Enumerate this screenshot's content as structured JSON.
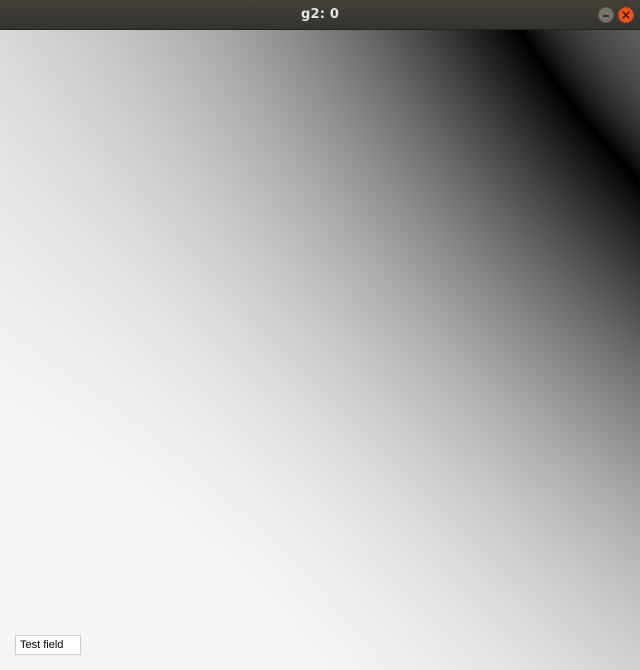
{
  "window": {
    "title": "g2: 0",
    "controls": {
      "minimize_icon": "minimize-icon",
      "close_icon": "close-icon",
      "close_color": "#e95420"
    }
  },
  "field": {
    "type": "grayscale-distance-field",
    "curve_color": "#000000",
    "bright_color": "#f4f4f4"
  },
  "text_field": {
    "value": "Test field"
  }
}
